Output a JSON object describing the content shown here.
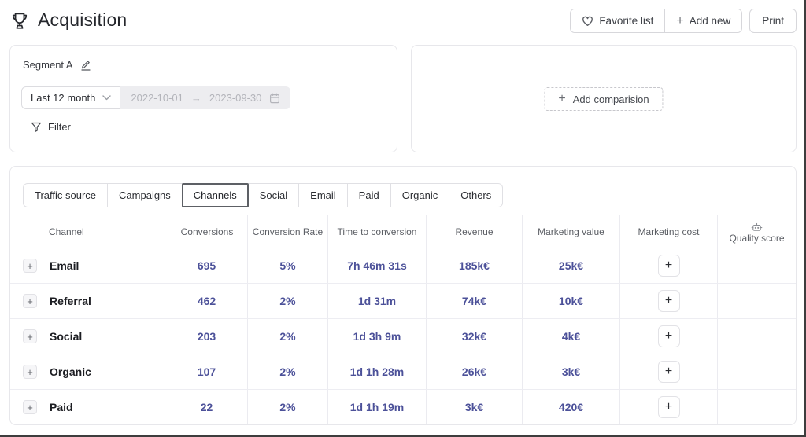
{
  "title": "Acquisition",
  "toolbar": {
    "favorite_list": "Favorite list",
    "add_new": "Add new",
    "print": "Print",
    "plus_symbol": "+"
  },
  "segment": {
    "name": "Segment A",
    "range_preset": "Last 12 month",
    "date_start": "2022-10-01",
    "date_arrow": "→",
    "date_end": "2023-09-30",
    "filter": "Filter"
  },
  "comparison": {
    "add_label": "Add comparision",
    "plus_symbol": "+"
  },
  "tabs": [
    {
      "label": "Traffic source",
      "active": false
    },
    {
      "label": "Campaigns",
      "active": false
    },
    {
      "label": "Channels",
      "active": true
    },
    {
      "label": "Social",
      "active": false
    },
    {
      "label": "Email",
      "active": false
    },
    {
      "label": "Paid",
      "active": false
    },
    {
      "label": "Organic",
      "active": false
    },
    {
      "label": "Others",
      "active": false
    }
  ],
  "table": {
    "columns": [
      "Channel",
      "Conversions",
      "Conversion Rate",
      "Time to conversion",
      "Revenue",
      "Marketing value",
      "Marketing cost",
      "Quality score"
    ],
    "expand_symbol": "+",
    "add_cost_symbol": "+",
    "rows": [
      {
        "channel": "Email",
        "conversions": "695",
        "rate": "5%",
        "time": "7h 46m 31s",
        "revenue": "185k€",
        "value": "25k€"
      },
      {
        "channel": "Referral",
        "conversions": "462",
        "rate": "2%",
        "time": "1d 31m",
        "revenue": "74k€",
        "value": "10k€"
      },
      {
        "channel": "Social",
        "conversions": "203",
        "rate": "2%",
        "time": "1d 3h 9m",
        "revenue": "32k€",
        "value": "4k€"
      },
      {
        "channel": "Organic",
        "conversions": "107",
        "rate": "2%",
        "time": "1d 1h 28m",
        "revenue": "26k€",
        "value": "3k€"
      },
      {
        "channel": "Paid",
        "conversions": "22",
        "rate": "2%",
        "time": "1d 1h 19m",
        "revenue": "3k€",
        "value": "420€"
      }
    ]
  },
  "colors": {
    "accent_value_text": "#4c5199",
    "active_tab_border": "#5d6065",
    "panel_border": "#e7e7eb",
    "disabled_field_bg": "#ededf0"
  }
}
